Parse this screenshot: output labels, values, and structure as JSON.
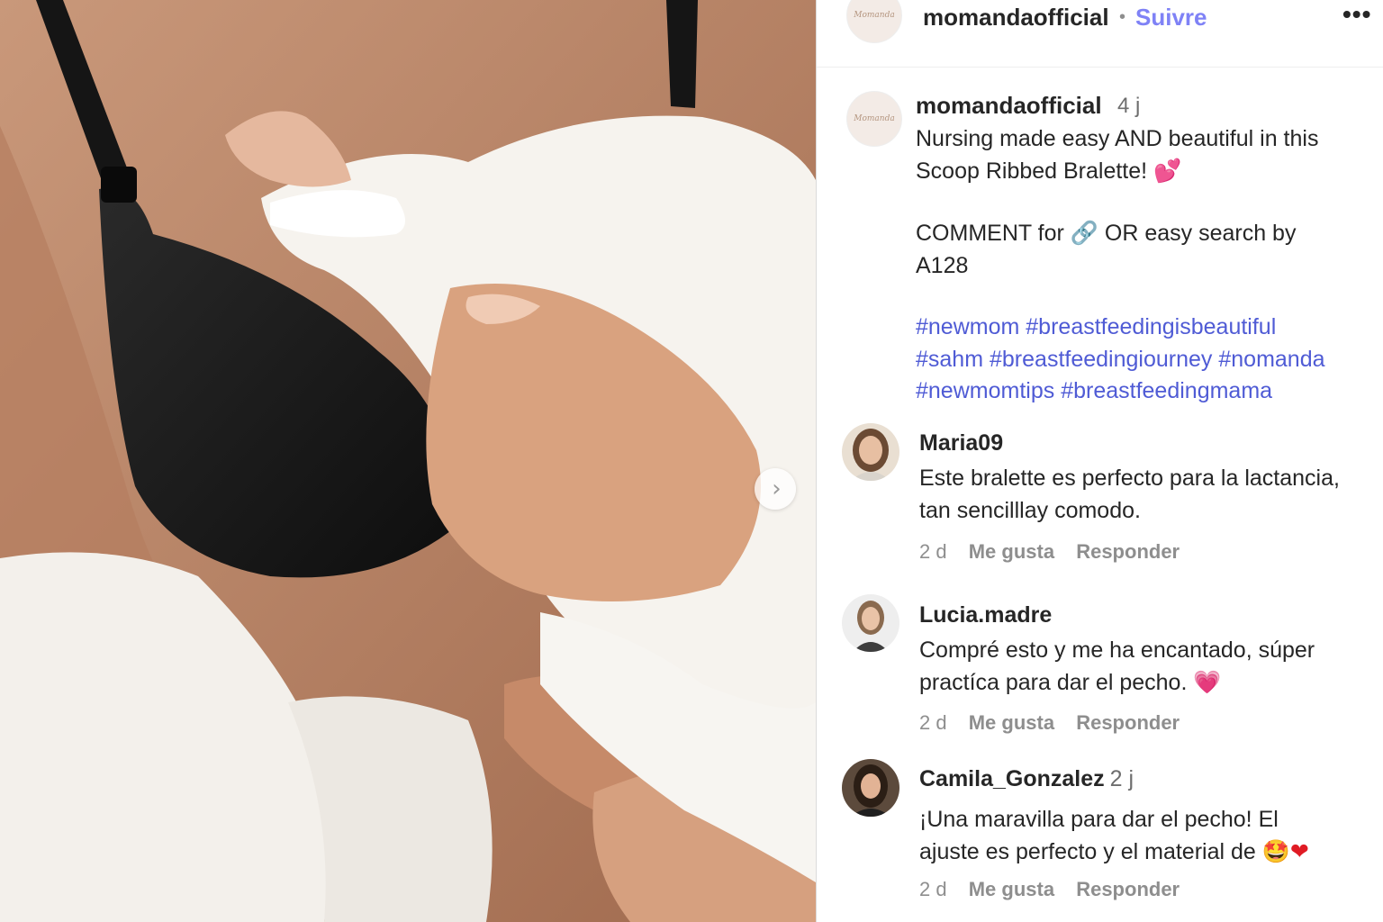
{
  "post": {
    "username": "momandaofficial",
    "follow_label": "Suivre",
    "separator": "•",
    "more_label": "•••",
    "brand_avatar_text": "Momanda",
    "next_arrow": "›"
  },
  "caption": {
    "username": "momandaofficial",
    "time": "4 j",
    "line1": "Nursing made easy AND beautiful in this",
    "line2": "Scoop Ribbed Bralette! 💕",
    "line3_pre": "COMMENT for",
    "line3_link_icon": "🔗",
    "line3_post": "OR easy search by",
    "line4": "A128",
    "hashtags": [
      "#newmom",
      "#breastfeedingisbeautiful",
      "#sahm",
      "#breastfeedingiourney",
      "#nomanda",
      "#newmomtips",
      "#breastfeedingmama"
    ]
  },
  "comments": [
    {
      "user": "Maria09",
      "time_inline": "",
      "line1": "Este bralette es perfecto para la lactancia,",
      "line2": "tan sencilllay comodo.",
      "age": "2 d",
      "like": "Me gusta",
      "reply": "Responder"
    },
    {
      "user": "Lucia.madre",
      "time_inline": "",
      "line1": "Compré esto y me ha encantado, súper",
      "line2": "practíca para dar el pecho.",
      "emoji": "💗",
      "age": "2 d",
      "like": "Me gusta",
      "reply": "Responder"
    },
    {
      "user": "Camila_Gonzalez",
      "time_inline": "2 j",
      "line1": "¡Una maravilla para dar el pecho! El",
      "line2": "ajuste es perfecto y el material de",
      "emoji": "🤩",
      "emoji2": "❤",
      "age": "2 d",
      "like": "Me gusta",
      "reply": "Responder"
    }
  ],
  "colors": {
    "follow": "#7f82f6",
    "hashtag": "#4f5bd5",
    "meta": "#8e8e8e"
  }
}
